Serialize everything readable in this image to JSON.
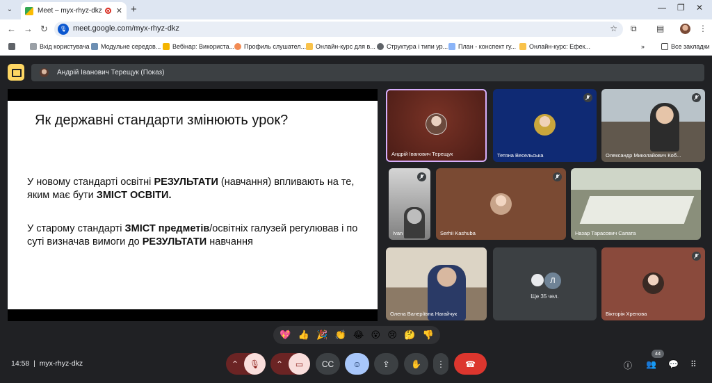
{
  "browser": {
    "tab_title": "Meet – myx-rhyz-dkz",
    "tab_close": "✕",
    "new_tab": "+",
    "url": "meet.google.com/myx-rhyz-dkz",
    "bookmarks": [
      "Вхід користувача",
      "Модульне середов...",
      "Вебінар: Використа...",
      "Профиль слушател...",
      "Онлайн-курс для в...",
      "Структура і типи ур...",
      "План - конспект гу...",
      "Онлайн-курс: Ефек..."
    ],
    "all_bookmarks": "Все закладки"
  },
  "meet": {
    "presenter_banner": "Андрій Іванович Терещук (Показ)",
    "slide": {
      "title": "Як державні стандарти змінюють урок?",
      "p1_pre": "У новому стандарті освітні ",
      "p1_bold1": "РЕЗУЛЬТАТИ",
      "p1_mid": " (навчання) впливають на те, яким має бути ",
      "p1_bold2": "ЗМІСТ ОСВІТИ.",
      "p2_pre": "У старому стандарті ",
      "p2_bold1": "ЗМІСТ предметів",
      "p2_mid": "/освітніх галузей регулював і по суті визначав вимоги до ",
      "p2_bold2": "РЕЗУЛЬТАТИ",
      "p2_end": " навчання"
    },
    "participants": [
      "Андрій Іванович Терещук",
      "Тетяна Весельська",
      "Олександр Миколайович Коб...",
      "Ivan",
      "Serhii Kashuba",
      "Назар Тарасович Сапата",
      "Олена Валеріївна Нагайчук",
      "Ще 35 чел.",
      "Вікторія Хренова"
    ],
    "others_initial": "Л",
    "reactions": [
      "💖",
      "👍",
      "🎉",
      "👏",
      "😂",
      "😮",
      "😢",
      "🤔",
      "👎"
    ],
    "time": "14:58",
    "meeting_code": "myx-rhyz-dkz",
    "people_count": "44"
  }
}
